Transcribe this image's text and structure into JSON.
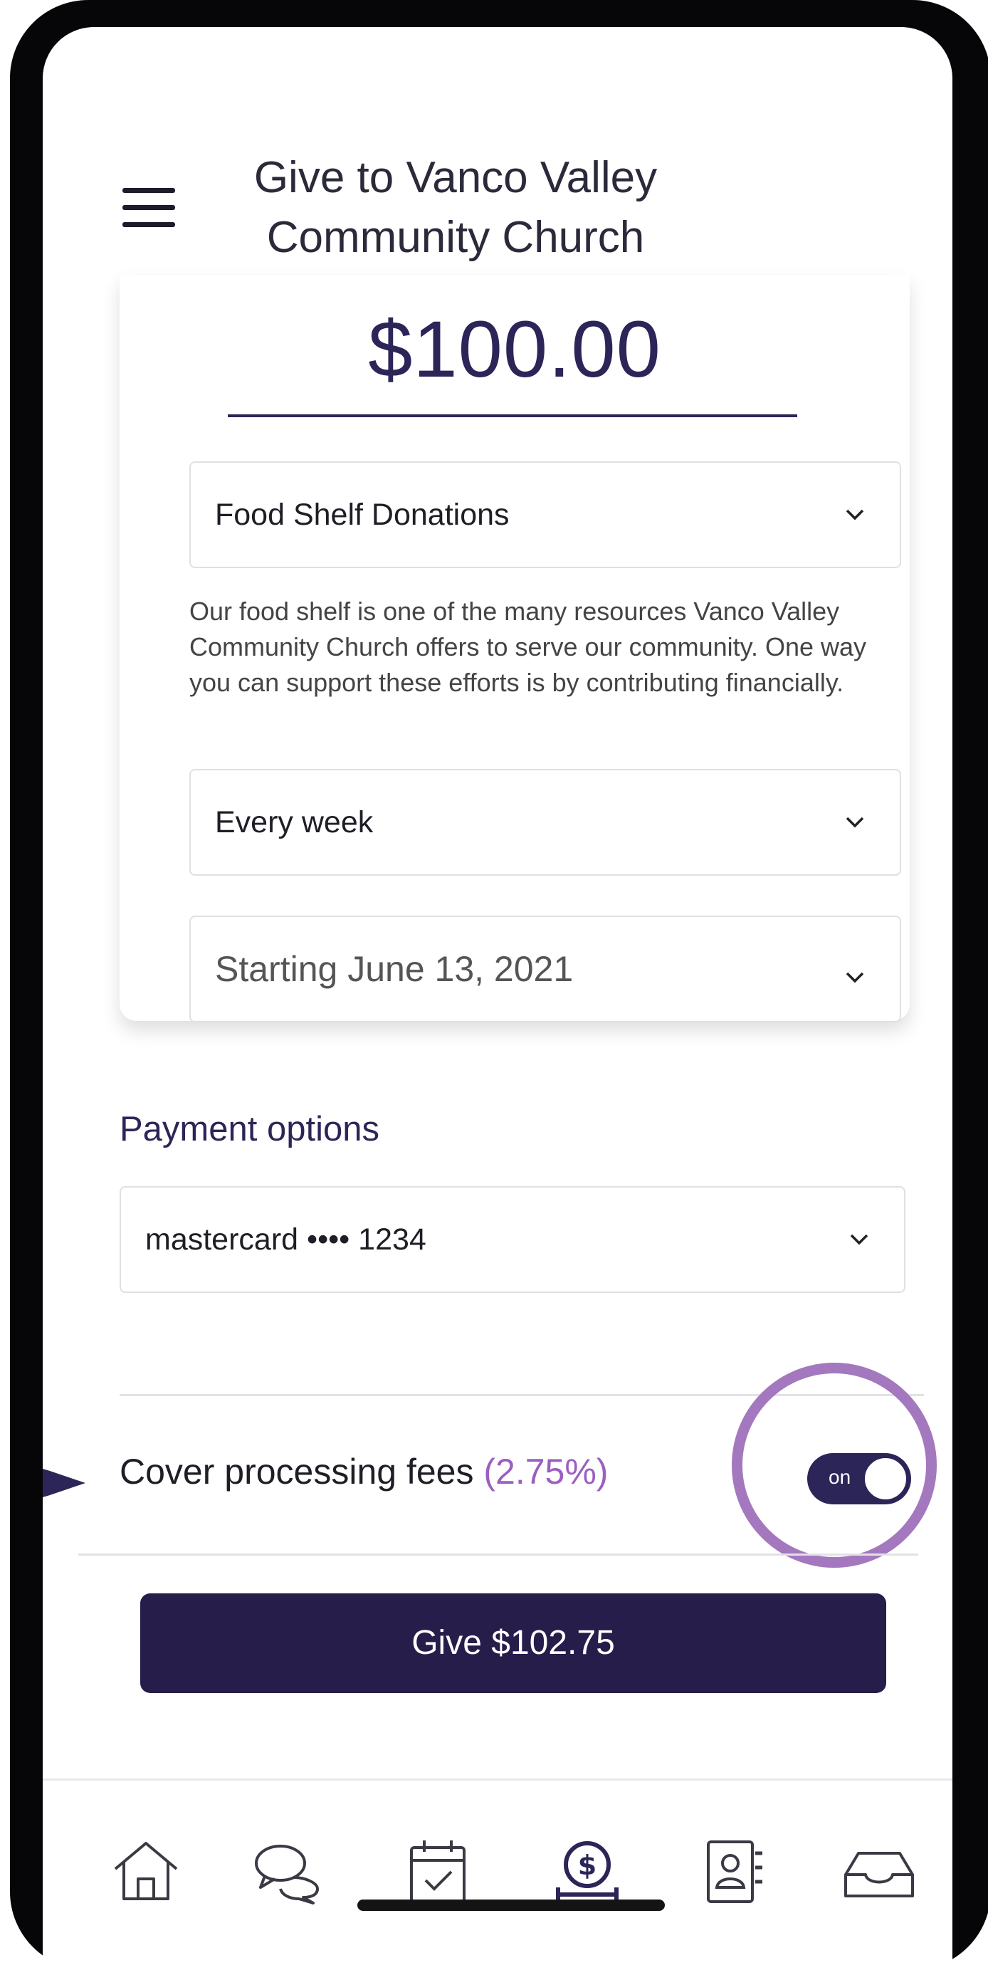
{
  "header": {
    "title": "Give to Vanco Valley\nCommunity Church"
  },
  "gift": {
    "amount": "$100.00",
    "fund": "Food Shelf Donations",
    "description": "Our food shelf is one of the many resources Vanco Valley Community Church offers to serve our community. One way you can support these efforts is by contributing financially.",
    "frequency": "Every week",
    "start": "Starting June 13, 2021"
  },
  "payment": {
    "title": "Payment options",
    "method": "mastercard •••• 1234"
  },
  "fees": {
    "label": "Cover processing fees",
    "percent": "(2.75%)",
    "toggle_text": "on",
    "enabled": true
  },
  "give_button": "Give $102.75",
  "tabbar": {
    "icons": [
      "home-icon",
      "chat-icon",
      "calendar-check-icon",
      "give-dollar-icon",
      "directory-icon",
      "inbox-icon"
    ],
    "active": "give-dollar-icon",
    "active_color": "#2b2558",
    "inactive_color": "#3a3a44"
  },
  "colors": {
    "accent": "#2b2558",
    "highlight": "#a478be",
    "button": "#261d4b"
  }
}
